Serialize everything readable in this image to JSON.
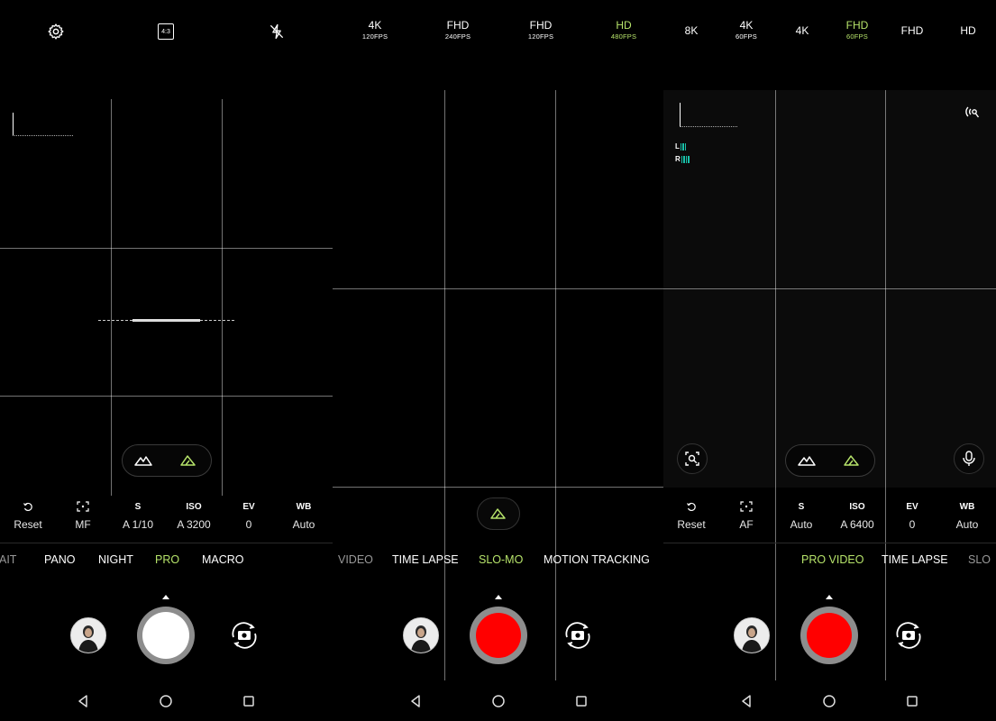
{
  "colors": {
    "accent": "#b6e36a",
    "record": "#ff0000",
    "audio_meter": "#18c0a8"
  },
  "panel1": {
    "top_icons": [
      "gear-icon",
      "aspect-ratio-icon",
      "flash-off-icon"
    ],
    "aspect_ratio": "4:3",
    "controls": [
      {
        "title": "",
        "value": "Reset",
        "icon": "reset-icon"
      },
      {
        "title": "",
        "value": "MF",
        "icon": "focus-icon"
      },
      {
        "title": "S",
        "value": "A 1/10"
      },
      {
        "title": "ISO",
        "value": "A 3200"
      },
      {
        "title": "EV",
        "value": "0"
      },
      {
        "title": "WB",
        "value": "Auto"
      }
    ],
    "modes": [
      "AIT",
      "PANO",
      "NIGHT",
      "PRO",
      "MACRO"
    ],
    "active_mode": "PRO"
  },
  "panel2": {
    "resolutions": [
      {
        "main": "4K",
        "sub": "120FPS"
      },
      {
        "main": "FHD",
        "sub": "240FPS"
      },
      {
        "main": "FHD",
        "sub": "120FPS"
      },
      {
        "main": "HD",
        "sub": "480FPS"
      }
    ],
    "active_resolution": "HD 480FPS",
    "modes": [
      "VIDEO",
      "TIME LAPSE",
      "SLO-MO",
      "MOTION TRACKING"
    ],
    "active_mode": "SLO-MO"
  },
  "panel3": {
    "resolutions": [
      {
        "main": "8K",
        "sub": ""
      },
      {
        "main": "4K",
        "sub": "60FPS"
      },
      {
        "main": "4K",
        "sub": ""
      },
      {
        "main": "FHD",
        "sub": "60FPS"
      },
      {
        "main": "FHD",
        "sub": ""
      },
      {
        "main": "HD",
        "sub": ""
      }
    ],
    "active_resolution": "FHD 60FPS",
    "audio_left": "L",
    "audio_right": "R",
    "controls": [
      {
        "title": "",
        "value": "Reset",
        "icon": "reset-icon"
      },
      {
        "title": "",
        "value": "AF",
        "icon": "focus-icon"
      },
      {
        "title": "S",
        "value": "Auto"
      },
      {
        "title": "ISO",
        "value": "A 6400"
      },
      {
        "title": "EV",
        "value": "0"
      },
      {
        "title": "WB",
        "value": "Auto"
      }
    ],
    "modes": [
      "PRO VIDEO",
      "TIME LAPSE",
      "SLO"
    ],
    "active_mode": "PRO VIDEO"
  },
  "nav_icons": [
    "back-icon",
    "home-icon",
    "recents-icon"
  ]
}
